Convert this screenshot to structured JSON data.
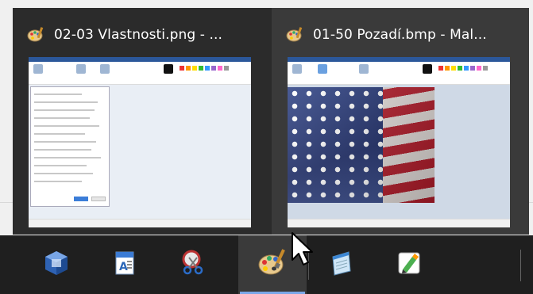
{
  "window_thumbnails": [
    {
      "title": "02-03 Vlastnosti.png - ...",
      "app_icon": "paint-icon"
    },
    {
      "title": "01-50 Pozadí.bmp - Mal...",
      "app_icon": "paint-icon"
    }
  ],
  "taskbar": {
    "items": [
      {
        "name": "virtualbox",
        "icon": "virtualbox-icon",
        "active": false
      },
      {
        "name": "wordpad",
        "icon": "wordpad-icon",
        "active": false
      },
      {
        "name": "snipping-tool",
        "icon": "scissors-icon",
        "active": false
      },
      {
        "name": "paint",
        "icon": "paint-palette-icon",
        "active": true
      },
      {
        "name": "notepad",
        "icon": "notepad-icon",
        "active": false
      },
      {
        "name": "app",
        "icon": "pen-app-icon",
        "active": false
      }
    ]
  },
  "colors": {
    "taskbar_bg": "#1f1f1f",
    "flyout_bg": "#2b2b2b",
    "hover_thumb_bg": "#3a3a3a",
    "active_indicator": "#7aa7e8"
  }
}
